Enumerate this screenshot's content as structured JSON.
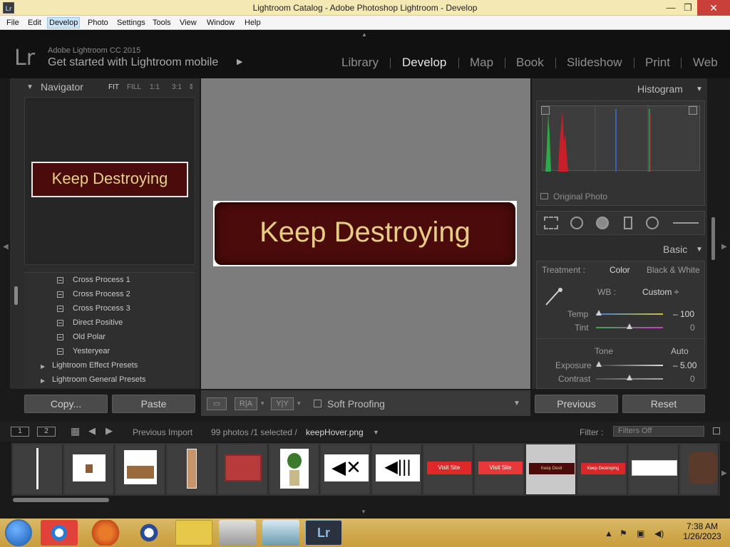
{
  "window": {
    "title": "Lightroom Catalog - Adobe Photoshop Lightroom - Develop",
    "app_icon": "Lr",
    "minimize": "—",
    "maximize": "❐",
    "close": "✕"
  },
  "menu": [
    "File",
    "Edit",
    "Develop",
    "Photo",
    "Settings",
    "Tools",
    "View",
    "Window",
    "Help"
  ],
  "menu_hovered": "Develop",
  "identity": {
    "logo": "Lr",
    "product": "Adobe Lightroom CC 2015",
    "tagline": "Get started with Lightroom mobile",
    "tagline_arrow": "▶"
  },
  "modules": [
    "Library",
    "Develop",
    "Map",
    "Book",
    "Slideshow",
    "Print",
    "Web"
  ],
  "active_module": "Develop",
  "navigator": {
    "title": "Navigator",
    "zoom": [
      "FIT",
      "FILL",
      "1:1",
      "3:1"
    ],
    "zoom_active": "FIT",
    "preview_text": "Keep Destroying"
  },
  "presets": {
    "items": [
      "Cross Process 1",
      "Cross Process 2",
      "Cross Process 3",
      "Direct Positive",
      "Old Polar",
      "Yesteryear"
    ],
    "folders": [
      "Lightroom Effect Presets",
      "Lightroom General Presets"
    ]
  },
  "left_buttons": {
    "copy": "Copy...",
    "paste": "Paste"
  },
  "image": {
    "text": "Keep Destroying"
  },
  "toolbar": {
    "view_ra": "R|A",
    "view_yy": "Y|Y",
    "soft_proofing": "Soft Proofing"
  },
  "histogram": {
    "title": "Histogram",
    "original_photo": "Original Photo"
  },
  "basic": {
    "title": "Basic",
    "treatment_label": "Treatment :",
    "treatment_color": "Color",
    "treatment_bw": "Black & White",
    "wb_label": "WB :",
    "wb_value": "Custom ÷",
    "temp_label": "Temp",
    "temp_value": "– 100",
    "tint_label": "Tint",
    "tint_value": "0",
    "tone_label": "Tone",
    "tone_auto": "Auto",
    "exposure_label": "Exposure",
    "exposure_value": "– 5.00",
    "contrast_label": "Contrast",
    "contrast_value": "0"
  },
  "right_buttons": {
    "previous": "Previous",
    "reset": "Reset"
  },
  "filmstrip": {
    "screen1": "1",
    "screen2": "2",
    "source": "Previous Import",
    "count": "99 photos /1 selected /",
    "filename": "keepHover.png",
    "filter_label": "Filter :",
    "filter_value": "Filters Off",
    "thumbs": {
      "visit_site_1": "Visit Site",
      "visit_site_2": "Visit Site",
      "keep_destr_small": "Keep Destr",
      "keep_destroying": "Keep Destroying"
    }
  },
  "taskbar": {
    "time": "7:38 AM",
    "date": "1/26/2023"
  }
}
